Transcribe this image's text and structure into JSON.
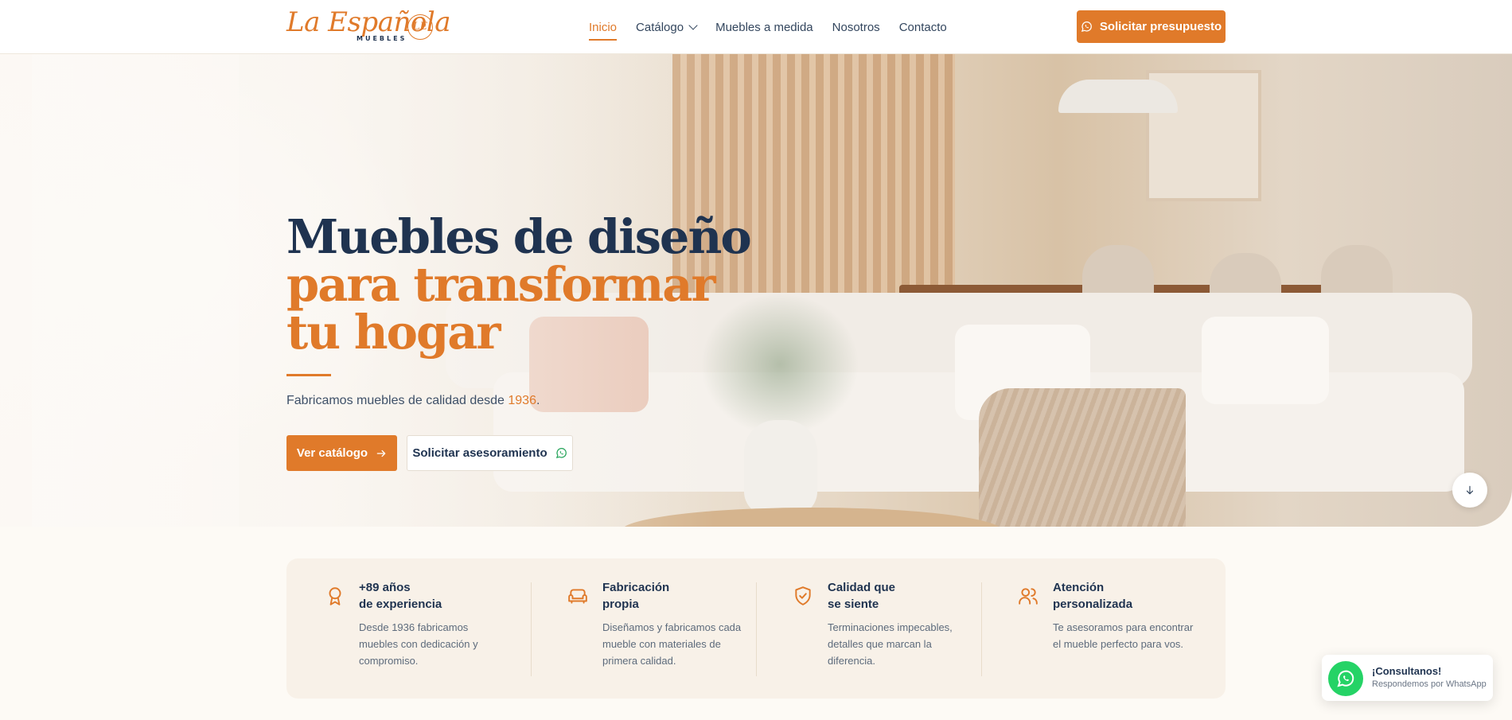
{
  "brand": {
    "logo_text": "La Española",
    "logo_sub": "MUEBLES",
    "logo_mark": "LE"
  },
  "nav": [
    {
      "label": "Inicio",
      "active": true
    },
    {
      "label": "Catálogo",
      "dropdown": true
    },
    {
      "label": "Muebles a medida"
    },
    {
      "label": "Nosotros"
    },
    {
      "label": "Contacto"
    }
  ],
  "header_cta": {
    "label": "Solicitar presupuesto",
    "icon": "whatsapp-icon"
  },
  "hero": {
    "title_line1": "Muebles de diseño",
    "title_line2": "para transformar",
    "title_line3": "tu hogar",
    "subtitle_prefix": "Fabricamos muebles de calidad desde ",
    "subtitle_year": "1936",
    "subtitle_suffix": ".",
    "primary_button": "Ver catálogo",
    "secondary_button": "Solicitar asesoramiento"
  },
  "features": [
    {
      "icon": "award-icon",
      "title": "+89 años\nde experiencia",
      "desc": "Desde 1936 fabricamos muebles con dedicación y compromiso."
    },
    {
      "icon": "sofa-icon",
      "title": "Fabricación\npropia",
      "desc": "Diseñamos y fabricamos cada mueble con materiales de primera calidad."
    },
    {
      "icon": "shield-check-icon",
      "title": "Calidad que\nse siente",
      "desc": "Terminaciones impecables, detalles que marcan la diferencia."
    },
    {
      "icon": "users-icon",
      "title": "Atención\npersonalizada",
      "desc": "Te asesoramos para encontrar el mueble perfecto para vos."
    }
  ],
  "whatsapp_widget": {
    "title": "¡Consultanos!",
    "subtitle": "Respondemos por WhatsApp"
  },
  "colors": {
    "accent": "#e07a2a",
    "navy": "#1f3350",
    "whatsapp": "#25d366",
    "cream": "#f8f1e8"
  }
}
